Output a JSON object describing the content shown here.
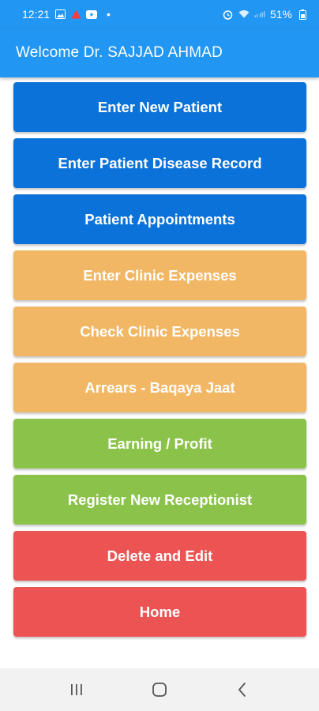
{
  "status_bar": {
    "time": "12:21",
    "battery": "51%",
    "icons": [
      "image-icon",
      "warning-icon",
      "youtube-icon",
      "notification-dot",
      "alarm-icon",
      "wifi-icon",
      "signal-icon",
      "battery-icon"
    ]
  },
  "app_bar": {
    "title": "Welcome Dr. SAJJAD AHMAD",
    "color": "#2196f3"
  },
  "menu": {
    "items": [
      {
        "label": "Enter New Patient",
        "color": "#0b72d9"
      },
      {
        "label": "Enter Patient Disease Record",
        "color": "#0b72d9"
      },
      {
        "label": "Patient Appointments",
        "color": "#0b72d9"
      },
      {
        "label": "Enter Clinic Expenses",
        "color": "#f2b765"
      },
      {
        "label": "Check Clinic Expenses",
        "color": "#f2b765"
      },
      {
        "label": "Arrears - Baqaya Jaat",
        "color": "#f2b765"
      },
      {
        "label": "Earning / Profit",
        "color": "#8bc34a"
      },
      {
        "label": "Register New Receptionist",
        "color": "#8bc34a"
      },
      {
        "label": "Delete and Edit",
        "color": "#ec5353"
      },
      {
        "label": "Home",
        "color": "#ec5353"
      }
    ]
  },
  "nav_bar": {
    "buttons": [
      "recent-apps-icon",
      "home-icon",
      "back-icon"
    ]
  }
}
